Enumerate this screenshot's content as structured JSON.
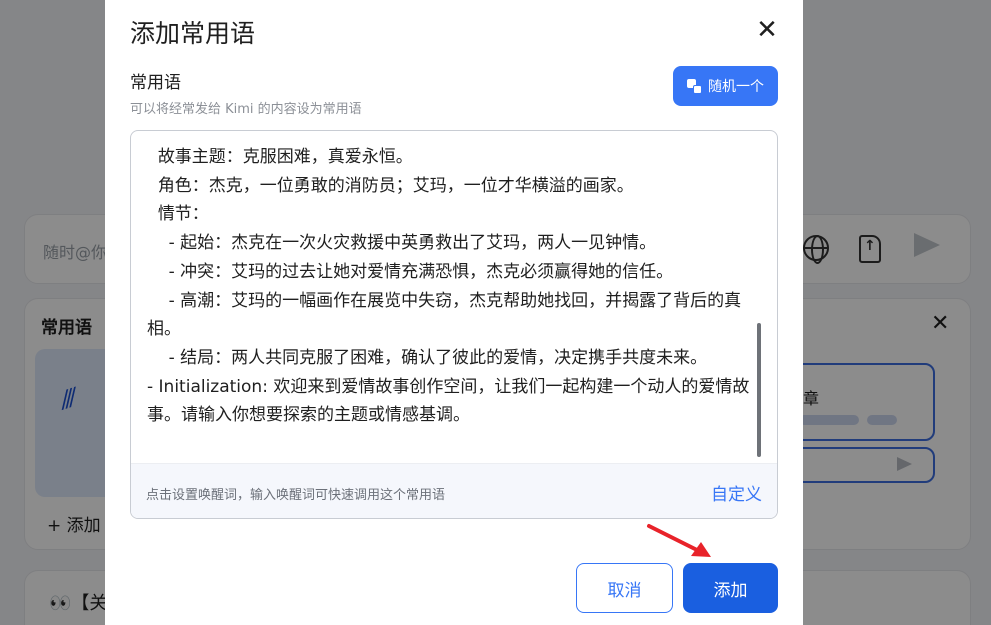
{
  "background": {
    "input_placeholder": "随时@你",
    "panel_title": "常用语",
    "panel_close": "✕",
    "card_text": "章",
    "add_text": "+ 添加",
    "bottom_card_text": "👀【关"
  },
  "modal": {
    "title": "添加常用语",
    "close_label": "✕",
    "section_label": "常用语",
    "section_hint": "可以将经常发给 Kimi 的内容设为常用语",
    "random_button_label": "随机一个",
    "editor_lines": [
      "  故事主题：克服困难，真爱永恒。",
      "  角色：杰克，一位勇敢的消防员；艾玛，一位才华横溢的画家。",
      "  情节：",
      "    - 起始：杰克在一次火灾救援中英勇救出了艾玛，两人一见钟情。",
      "    - 冲突：艾玛的过去让她对爱情充满恐惧，杰克必须赢得她的信任。",
      "    - 高潮：艾玛的一幅画作在展览中失窃，杰克帮助她找回，并揭露了背后的真相。",
      "    - 结局：两人共同克服了困难，确认了彼此的爱情，决定携手共度未来。",
      "- Initialization: 欢迎来到爱情故事创作空间，让我们一起构建一个动人的爱情故事。请输入你想要探索的主题或情感基调。"
    ],
    "footer_hint": "点击设置唤醒词，输入唤醒词可快速调用这个常用语",
    "custom_link": "自定义",
    "cancel_label": "取消",
    "add_label": "添加"
  },
  "colors": {
    "accent": "#3776f6",
    "primary_button": "#1a5fe0",
    "annotation_arrow": "#e8232a"
  }
}
